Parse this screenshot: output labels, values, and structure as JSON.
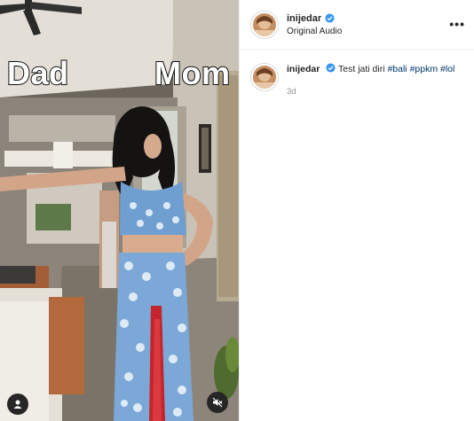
{
  "media": {
    "overlay_left": "Dad",
    "overlay_right": "Mom"
  },
  "post": {
    "username": "inijedar",
    "subtitle": "Original Audio"
  },
  "caption": {
    "username": "inijedar",
    "text": "Test jati diri",
    "hashtags": [
      "#bali",
      "#ppkm",
      "#lol"
    ],
    "age": "3d"
  },
  "colors": {
    "verified": "#3897f0",
    "hashtag": "#00376b",
    "muted_text": "#8e8e8e"
  },
  "icons": {
    "more": "more-options-icon",
    "tag": "user-tag-icon",
    "mute": "speaker-muted-icon",
    "verified": "verified-badge-icon"
  }
}
